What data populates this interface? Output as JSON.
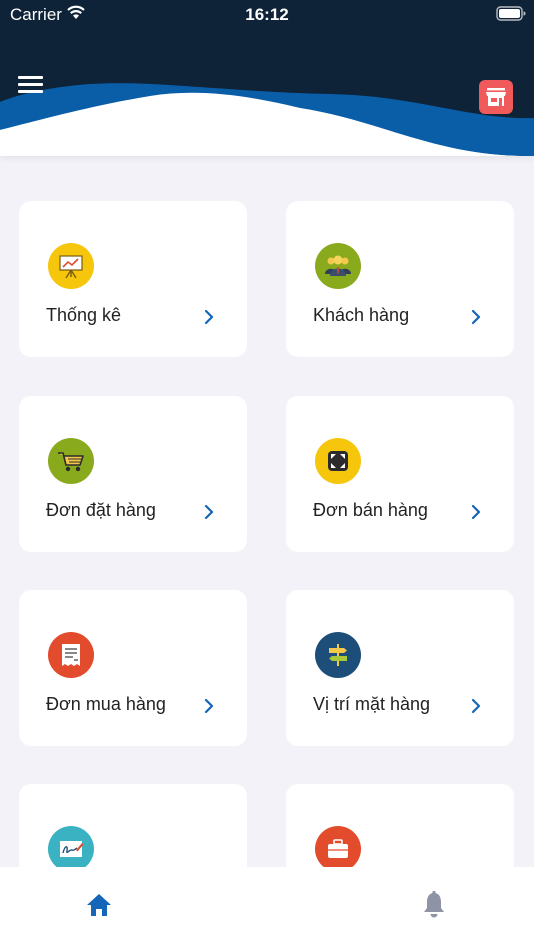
{
  "status_bar": {
    "carrier": "Carrier",
    "time": "16:12"
  },
  "header": {
    "menu_icon": "hamburger-menu-icon",
    "store_icon": "store-icon",
    "store_color": "#f05a5a",
    "wave_dark": "#0e2338",
    "wave_blue": "#0a5ea8"
  },
  "menu_items": [
    {
      "label": "Thống kê",
      "icon": "chart-presentation-icon",
      "color": "#f6c60c"
    },
    {
      "label": "Khách hàng",
      "icon": "customers-icon",
      "color": "#8aaa1e"
    },
    {
      "label": "Đơn đặt hàng",
      "icon": "shopping-cart-icon",
      "color": "#8aaa1e"
    },
    {
      "label": "Đơn bán hàng",
      "icon": "expand-arrows-icon",
      "color": "#f6c60c"
    },
    {
      "label": "Đơn mua hàng",
      "icon": "receipt-icon",
      "color": "#e24b2b"
    },
    {
      "label": "Vị trí mặt hàng",
      "icon": "signpost-icon",
      "color": "#1d4e7a"
    },
    {
      "label": "",
      "icon": "signature-icon",
      "color": "#3bb2c2"
    },
    {
      "label": "",
      "icon": "briefcase-icon",
      "color": "#e24b2b"
    }
  ],
  "tabbar": {
    "home_icon": "home-icon",
    "home_color": "#1565b8",
    "bell_icon": "bell-icon",
    "bell_color": "#8e93a6"
  }
}
